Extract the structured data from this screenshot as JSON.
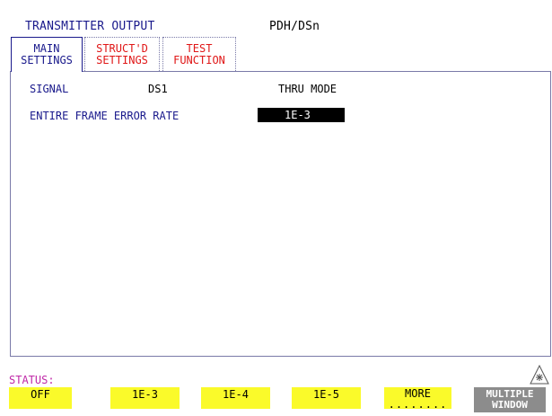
{
  "header": {
    "title": "TRANSMITTER OUTPUT",
    "mode": "PDH/DSn"
  },
  "tabs": [
    {
      "line1": "MAIN",
      "line2": "SETTINGS",
      "active": true
    },
    {
      "line1": "STRUCT'D",
      "line2": "SETTINGS",
      "active": false
    },
    {
      "line1": "TEST",
      "line2": "FUNCTION",
      "active": false
    }
  ],
  "main": {
    "signal_label": "SIGNAL",
    "signal_value": "DS1",
    "thru_mode": "THRU MODE",
    "frame_error_label": "ENTIRE FRAME ERROR RATE",
    "frame_error_value": "1E-3"
  },
  "status": {
    "label": "STATUS:"
  },
  "softkeys": {
    "off": "OFF",
    "e3": "1E-3",
    "e4": "1E-4",
    "e5": "1E-5",
    "more": "MORE",
    "more_dots": "........",
    "multi_line1": "MULTIPLE",
    "multi_line2": "WINDOW"
  },
  "colors": {
    "label_blue": "#1a1a8c",
    "tab_red": "#e01818",
    "softkey_yellow": "#fafa2a",
    "status_magenta": "#c02aa8",
    "multi_gray": "#8c8c8c"
  },
  "icons": {
    "multi_window": "burst-icon"
  }
}
